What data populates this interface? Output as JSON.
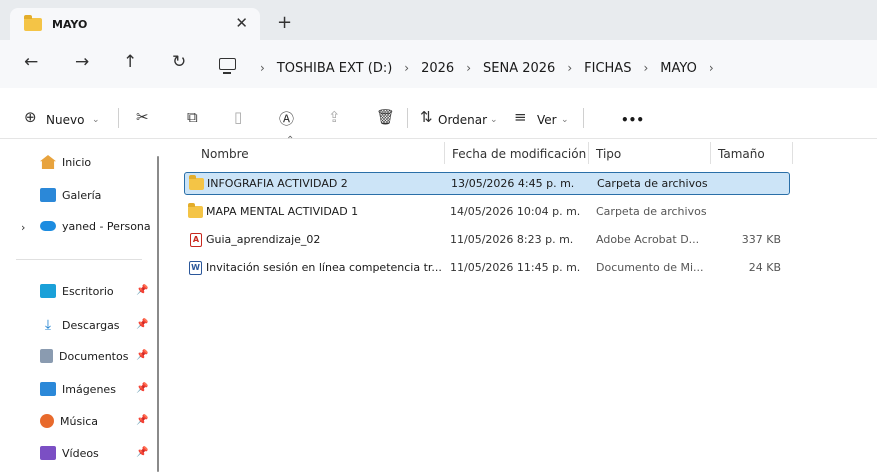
{
  "window": {
    "tab_title": "MAYO",
    "tab_close": "✕",
    "new_tab": "+"
  },
  "nav": {
    "back": "←",
    "forward": "→",
    "up": "↑",
    "refresh": "↻"
  },
  "breadcrumb": {
    "items": [
      "TOSHIBA EXT (D:)",
      "2026",
      "SENA 2026",
      "FICHAS",
      "MAYO"
    ],
    "separator": "›"
  },
  "toolbar": {
    "new_label": "Nuevo",
    "sort_label": "Ordenar",
    "view_label": "Ver",
    "more": "•••"
  },
  "sidebar": {
    "items": [
      {
        "label": "Inicio",
        "icon": "home-icon"
      },
      {
        "label": "Galería",
        "icon": "gallery-icon"
      },
      {
        "label": "yaned - Persona",
        "icon": "onedrive-icon"
      },
      {
        "label": "Escritorio",
        "icon": "desktop-icon"
      },
      {
        "label": "Descargas",
        "icon": "downloads-icon"
      },
      {
        "label": "Documentos",
        "icon": "documents-icon"
      },
      {
        "label": "Imágenes",
        "icon": "pictures-icon"
      },
      {
        "label": "Música",
        "icon": "music-icon"
      },
      {
        "label": "Vídeos",
        "icon": "videos-icon"
      }
    ]
  },
  "columns": {
    "name": "Nombre",
    "date": "Fecha de modificación",
    "type": "Tipo",
    "size": "Tamaño"
  },
  "files": [
    {
      "name": "INFOGRAFIA ACTIVIDAD 2",
      "date": "13/05/2026 4:45 p. m.",
      "type": "Carpeta de archivos",
      "size": "",
      "icon": "folder-icon",
      "selected": true
    },
    {
      "name": "MAPA MENTAL ACTIVIDAD 1",
      "date": "14/05/2026 10:04 p. m.",
      "type": "Carpeta de archivos",
      "size": "",
      "icon": "folder-icon",
      "selected": false
    },
    {
      "name": "Guia_aprendizaje_02",
      "date": "11/05/2026 8:23 p. m.",
      "type": "Adobe Acrobat D...",
      "size": "337 KB",
      "icon": "pdf-icon",
      "selected": false
    },
    {
      "name": "Invitación sesión en línea competencia tr...",
      "date": "11/05/2026 11:45 p. m.",
      "type": "Documento de Mi...",
      "size": "24 KB",
      "icon": "word-icon",
      "selected": false
    }
  ],
  "colors": {
    "selection_bg": "#cce4f7",
    "selection_border": "#2a6fa8",
    "folder": "#f4c446"
  }
}
